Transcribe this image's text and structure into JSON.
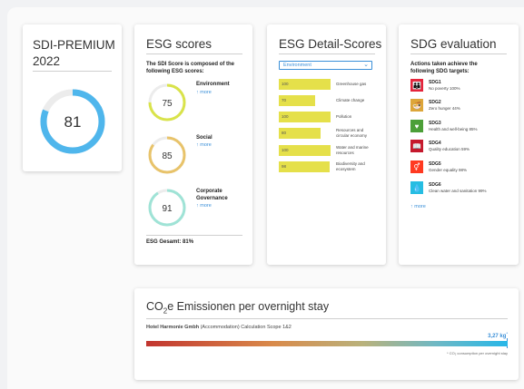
{
  "sdi": {
    "title_line1": "SDI-PREMIUM",
    "title_line2": "2022",
    "score": "81",
    "score_value": 81
  },
  "esg": {
    "title": "ESG scores",
    "intro": "The SDI Score is composed of the following ESG scores:",
    "items": [
      {
        "name": "Environment",
        "score": "75",
        "value": 75,
        "more": "↑ more"
      },
      {
        "name": "Social",
        "score": "85",
        "value": 85,
        "more": "↑ more"
      },
      {
        "name_line1": "Corporate",
        "name_line2": "Governance",
        "score": "91",
        "value": 91,
        "more": "↑ more"
      }
    ],
    "total": "ESG Gesamt: 81%",
    "colors": {
      "environment": "#d9e34a",
      "social": "#e8c36a",
      "governance": "#9fe3d6",
      "track": "#ececec"
    }
  },
  "detail": {
    "title": "ESG Detail-Scores",
    "select_value": "Environment",
    "bars": [
      {
        "value": "100",
        "fill": 1.0,
        "label_line1": "Greenhouse gas",
        "label_line2": ""
      },
      {
        "value": "70",
        "fill": 0.7,
        "label_line1": "Climate change",
        "label_line2": ""
      },
      {
        "value": "100",
        "fill": 1.0,
        "label_line1": "Pollution",
        "label_line2": ""
      },
      {
        "value": "80",
        "fill": 0.8,
        "label_line1": "Resources and",
        "label_line2": "circular economy"
      },
      {
        "value": "100",
        "fill": 1.0,
        "label_line1": "Water and marine",
        "label_line2": "resources"
      },
      {
        "value": "98",
        "fill": 0.98,
        "label_line1": "Biodiversity and",
        "label_line2": "ecosystem"
      }
    ],
    "bar_color": "#e5e04a"
  },
  "sdg": {
    "title": "SDG evaluation",
    "intro": "Actions taken achieve the following SDG targets:",
    "items": [
      {
        "code": "SDG1",
        "desc": "No poverty 100%",
        "color": "#e5243b",
        "icon": "people-icon"
      },
      {
        "code": "SDG2",
        "desc": "Zero hunger 44%",
        "color": "#dda63a",
        "icon": "bowl-icon"
      },
      {
        "code": "SDG3",
        "desc": "Health and well-being 85%",
        "color": "#4c9f38",
        "icon": "heartbeat-icon"
      },
      {
        "code": "SDG4",
        "desc": "Quality education 59%",
        "color": "#c5192d",
        "icon": "book-icon"
      },
      {
        "code": "SDG5",
        "desc": "Gender equality 98%",
        "color": "#ff3a21",
        "icon": "gender-icon"
      },
      {
        "code": "SDG6",
        "desc": "Clean water and sanitation 99%",
        "color": "#26bde2",
        "icon": "water-icon"
      }
    ],
    "more": "↑ more"
  },
  "co2": {
    "title_prefix": "CO",
    "title_sub": "2",
    "title_suffix": "e Emissionen per overnight stay",
    "hotel_name": "Hotel Harmonie Gmbh",
    "hotel_rest": " (Accommodation) Calculation Scope 1&2",
    "value": "3,27 kg",
    "footnote": "* CO₂ consumption per overnight stay"
  }
}
